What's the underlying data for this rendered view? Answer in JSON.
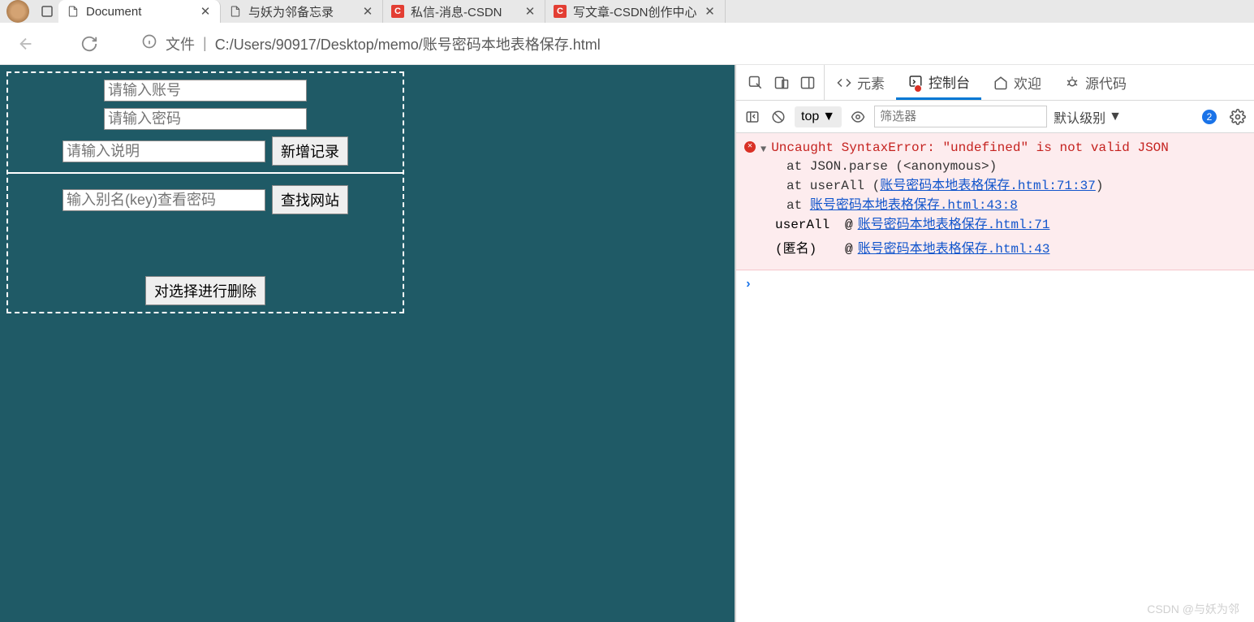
{
  "tabs": [
    {
      "title": "Document",
      "type": "file"
    },
    {
      "title": "与妖为邻备忘录",
      "type": "file"
    },
    {
      "title": "私信-消息-CSDN",
      "type": "csdn"
    },
    {
      "title": "写文章-CSDN创作中心",
      "type": "csdn"
    }
  ],
  "urlbar": {
    "label": "文件",
    "path": "C:/Users/90917/Desktop/memo/账号密码本地表格保存.html"
  },
  "page": {
    "input_account_ph": "请输入账号",
    "input_password_ph": "请输入密码",
    "input_desc_ph": "请输入说明",
    "btn_add": "新增记录",
    "input_alias_ph": "输入别名(key)查看密码",
    "btn_find": "查找网站",
    "btn_delete": "对选择进行删除"
  },
  "devtools": {
    "tabs": {
      "elements": "元素",
      "console": "控制台",
      "welcome": "欢迎",
      "sources": "源代码"
    },
    "context": "top",
    "filter_ph": "筛选器",
    "level": "默认级别",
    "issue_count": "2",
    "error": {
      "msg": "Uncaught SyntaxError: \"undefined\" is not valid JSON",
      "at1": "at JSON.parse (<anonymous>)",
      "at2_pre": "at userAll (",
      "at2_link": "账号密码本地表格保存.html:71:37",
      "at2_post": ")",
      "at3_pre": "at ",
      "at3_link": "账号密码本地表格保存.html:43:8",
      "tr1_fn": "userAll",
      "tr1_link": "账号密码本地表格保存.html:71",
      "tr2_fn": "(匿名)",
      "tr2_link": "账号密码本地表格保存.html:43"
    }
  },
  "watermark": "CSDN @与妖为邻"
}
